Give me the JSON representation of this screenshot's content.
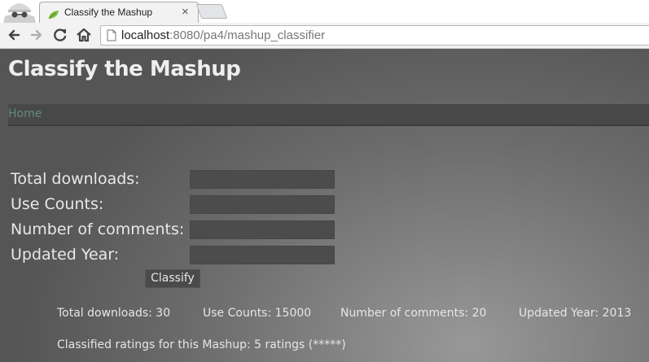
{
  "browser": {
    "tab_title": "Classify the Mashup",
    "tab_close": "×",
    "url_host": "localhost",
    "url_path": ":8080/pa4/mashup_classifier"
  },
  "page": {
    "title": "Classify the Mashup",
    "nav": {
      "home_label": "Home"
    },
    "form": {
      "fields": [
        {
          "label": "Total downloads:",
          "value": ""
        },
        {
          "label": "Use Counts:",
          "value": ""
        },
        {
          "label": "Number of comments:",
          "value": ""
        },
        {
          "label": "Updated Year:",
          "value": ""
        }
      ],
      "submit_label": "Classify"
    },
    "results": {
      "downloads": "Total downloads: 30",
      "use_counts": "Use Counts: 15000",
      "comments": "Number of comments: 20",
      "updated_year": "Updated Year: 2013",
      "rating": "Classified ratings for this Mashup: 5 ratings (*****)"
    }
  },
  "colors": {
    "page_background": "#6c6c6c",
    "nav_link": "#5f8f7a",
    "input_background": "#4c4c4c"
  }
}
